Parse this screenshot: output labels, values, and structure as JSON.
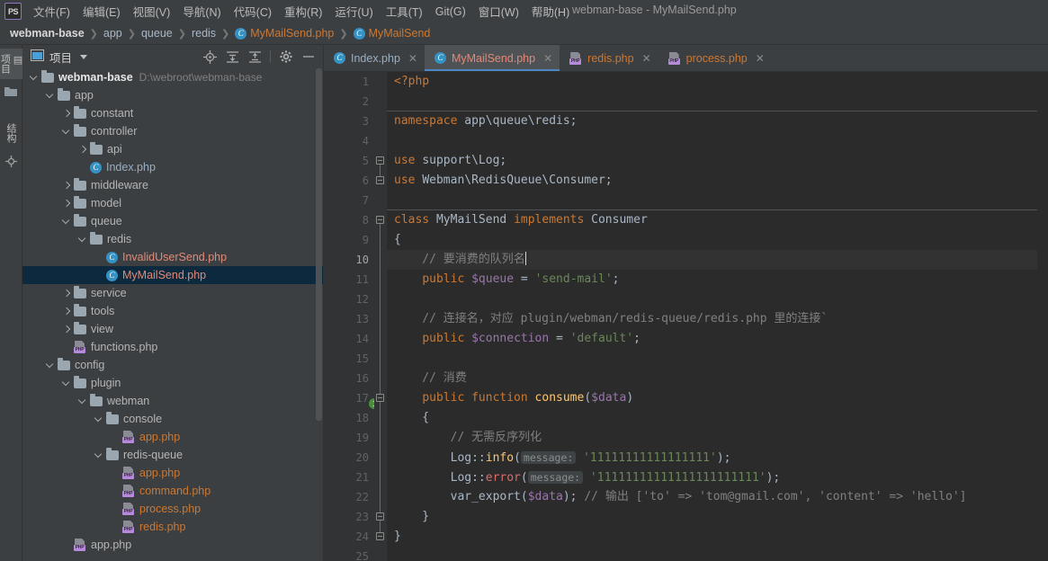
{
  "window": {
    "title": "webman-base - MyMailSend.php",
    "logo_text": "PS"
  },
  "menubar": {
    "items": [
      {
        "label": "文件(F)",
        "name": "menu-file"
      },
      {
        "label": "编辑(E)",
        "name": "menu-edit"
      },
      {
        "label": "视图(V)",
        "name": "menu-view"
      },
      {
        "label": "导航(N)",
        "name": "menu-navigate"
      },
      {
        "label": "代码(C)",
        "name": "menu-code"
      },
      {
        "label": "重构(R)",
        "name": "menu-refactor"
      },
      {
        "label": "运行(U)",
        "name": "menu-run"
      },
      {
        "label": "工具(T)",
        "name": "menu-tools"
      },
      {
        "label": "Git(G)",
        "name": "menu-git"
      },
      {
        "label": "窗口(W)",
        "name": "menu-window"
      },
      {
        "label": "帮助(H)",
        "name": "menu-help"
      }
    ]
  },
  "breadcrumb": {
    "items": [
      {
        "label": "webman-base",
        "kind": "root"
      },
      {
        "label": "app",
        "kind": "dir"
      },
      {
        "label": "queue",
        "kind": "dir"
      },
      {
        "label": "redis",
        "kind": "dir"
      },
      {
        "label": "MyMailSend.php",
        "kind": "file"
      },
      {
        "label": "MyMailSend",
        "kind": "class"
      }
    ],
    "separator": "❯"
  },
  "toolstrip": {
    "project_label": "项目",
    "structure_label": "结构"
  },
  "project_panel": {
    "title": "项目",
    "tools": [
      "locate-icon",
      "expand-all-icon",
      "collapse-all-icon",
      "settings-icon",
      "hide-icon"
    ],
    "tree": [
      {
        "indent": 0,
        "arrow": "open",
        "icon": "folder",
        "label": "webman-base",
        "style": "root",
        "path": "D:\\webroot\\webman-base"
      },
      {
        "indent": 1,
        "arrow": "open",
        "icon": "folder",
        "label": "app",
        "style": "dir"
      },
      {
        "indent": 2,
        "arrow": "closed",
        "icon": "folder",
        "label": "constant",
        "style": "dir"
      },
      {
        "indent": 2,
        "arrow": "open",
        "icon": "folder",
        "label": "controller",
        "style": "dir"
      },
      {
        "indent": 3,
        "arrow": "closed",
        "icon": "folder",
        "label": "api",
        "style": "dir"
      },
      {
        "indent": 3,
        "arrow": "none",
        "icon": "class",
        "label": "Index.php",
        "style": "file-blue"
      },
      {
        "indent": 2,
        "arrow": "closed",
        "icon": "folder",
        "label": "middleware",
        "style": "dir"
      },
      {
        "indent": 2,
        "arrow": "closed",
        "icon": "folder",
        "label": "model",
        "style": "dir"
      },
      {
        "indent": 2,
        "arrow": "open",
        "icon": "folder",
        "label": "queue",
        "style": "dir"
      },
      {
        "indent": 3,
        "arrow": "open",
        "icon": "folder",
        "label": "redis",
        "style": "dir"
      },
      {
        "indent": 4,
        "arrow": "none",
        "icon": "class",
        "label": "InvalidUserSend.php",
        "style": "cls"
      },
      {
        "indent": 4,
        "arrow": "none",
        "icon": "class",
        "label": "MyMailSend.php",
        "style": "cls",
        "selected": true
      },
      {
        "indent": 2,
        "arrow": "closed",
        "icon": "folder",
        "label": "service",
        "style": "dir"
      },
      {
        "indent": 2,
        "arrow": "closed",
        "icon": "folder",
        "label": "tools",
        "style": "dir"
      },
      {
        "indent": 2,
        "arrow": "closed",
        "icon": "folder",
        "label": "view",
        "style": "dir"
      },
      {
        "indent": 2,
        "arrow": "none",
        "icon": "php",
        "label": "functions.php",
        "style": "dir"
      },
      {
        "indent": 1,
        "arrow": "open",
        "icon": "folder",
        "label": "config",
        "style": "dir"
      },
      {
        "indent": 2,
        "arrow": "open",
        "icon": "folder",
        "label": "plugin",
        "style": "dir"
      },
      {
        "indent": 3,
        "arrow": "open",
        "icon": "folder",
        "label": "webman",
        "style": "dir"
      },
      {
        "indent": 4,
        "arrow": "open",
        "icon": "folder",
        "label": "console",
        "style": "dir"
      },
      {
        "indent": 5,
        "arrow": "none",
        "icon": "php",
        "label": "app.php",
        "style": "php"
      },
      {
        "indent": 4,
        "arrow": "open",
        "icon": "folder",
        "label": "redis-queue",
        "style": "dir"
      },
      {
        "indent": 5,
        "arrow": "none",
        "icon": "php",
        "label": "app.php",
        "style": "php"
      },
      {
        "indent": 5,
        "arrow": "none",
        "icon": "php",
        "label": "command.php",
        "style": "php"
      },
      {
        "indent": 5,
        "arrow": "none",
        "icon": "php",
        "label": "process.php",
        "style": "php"
      },
      {
        "indent": 5,
        "arrow": "none",
        "icon": "php",
        "label": "redis.php",
        "style": "php"
      },
      {
        "indent": 2,
        "arrow": "none",
        "icon": "php",
        "label": "app.php",
        "style": "dir"
      }
    ]
  },
  "editor": {
    "tabs": [
      {
        "label": "Index.php",
        "icon": "class-icon",
        "active": false,
        "color": "blue"
      },
      {
        "label": "MyMailSend.php",
        "icon": "class-icon",
        "active": true,
        "color": "orange"
      },
      {
        "label": "redis.php",
        "icon": "php-icon",
        "active": false,
        "color": "orange"
      },
      {
        "label": "process.php",
        "icon": "php-icon",
        "active": false,
        "color": "orange"
      }
    ],
    "close_glyph": "✕",
    "gutter_marker_line17": "1",
    "line_numbers": [
      1,
      2,
      3,
      4,
      5,
      6,
      7,
      8,
      9,
      10,
      11,
      12,
      13,
      14,
      15,
      16,
      17,
      18,
      19,
      20,
      21,
      22,
      23,
      24,
      25
    ],
    "current_line": 10,
    "code_lines": [
      {
        "n": 1,
        "tokens": [
          {
            "t": "<?php",
            "c": "kw"
          }
        ]
      },
      {
        "n": 2,
        "tokens": []
      },
      {
        "n": 3,
        "tokens": [
          {
            "t": "namespace ",
            "c": "kw"
          },
          {
            "t": "app\\queue\\redis;",
            "c": "cls2"
          }
        ]
      },
      {
        "n": 4,
        "tokens": []
      },
      {
        "n": 5,
        "tokens": [
          {
            "t": "use ",
            "c": "kw"
          },
          {
            "t": "support\\Log;",
            "c": "cls2"
          }
        ]
      },
      {
        "n": 6,
        "tokens": [
          {
            "t": "use ",
            "c": "kw"
          },
          {
            "t": "Webman\\RedisQueue\\Consumer;",
            "c": "cls2"
          }
        ]
      },
      {
        "n": 7,
        "tokens": []
      },
      {
        "n": 8,
        "tokens": [
          {
            "t": "class ",
            "c": "kw"
          },
          {
            "t": "MyMailSend ",
            "c": "cls2"
          },
          {
            "t": "implements ",
            "c": "kw"
          },
          {
            "t": "Consumer",
            "c": "cls2"
          }
        ]
      },
      {
        "n": 9,
        "tokens": [
          {
            "t": "{",
            "c": "cls2"
          }
        ]
      },
      {
        "n": 10,
        "tokens": [
          {
            "t": "    // 要消费的队列名",
            "c": "cmt"
          }
        ],
        "caret": true,
        "highlight": true
      },
      {
        "n": 11,
        "tokens": [
          {
            "t": "    ",
            "c": "cls2"
          },
          {
            "t": "public ",
            "c": "kw"
          },
          {
            "t": "$queue",
            "c": "var"
          },
          {
            "t": " = ",
            "c": "cls2"
          },
          {
            "t": "'send-mail'",
            "c": "str"
          },
          {
            "t": ";",
            "c": "cls2"
          }
        ]
      },
      {
        "n": 12,
        "tokens": []
      },
      {
        "n": 13,
        "tokens": [
          {
            "t": "    // 连接名，对应 plugin/webman/redis-queue/redis.php 里的连接`",
            "c": "cmt"
          }
        ]
      },
      {
        "n": 14,
        "tokens": [
          {
            "t": "    ",
            "c": "cls2"
          },
          {
            "t": "public ",
            "c": "kw"
          },
          {
            "t": "$connection",
            "c": "var"
          },
          {
            "t": " = ",
            "c": "cls2"
          },
          {
            "t": "'default'",
            "c": "str"
          },
          {
            "t": ";",
            "c": "cls2"
          }
        ]
      },
      {
        "n": 15,
        "tokens": []
      },
      {
        "n": 16,
        "tokens": [
          {
            "t": "    // 消费",
            "c": "cmt"
          }
        ]
      },
      {
        "n": 17,
        "tokens": [
          {
            "t": "    ",
            "c": "cls2"
          },
          {
            "t": "public function ",
            "c": "kw"
          },
          {
            "t": "consume",
            "c": "fn"
          },
          {
            "t": "(",
            "c": "cls2"
          },
          {
            "t": "$data",
            "c": "var"
          },
          {
            "t": ")",
            "c": "cls2"
          }
        ]
      },
      {
        "n": 18,
        "tokens": [
          {
            "t": "    {",
            "c": "cls2"
          }
        ]
      },
      {
        "n": 19,
        "tokens": [
          {
            "t": "        // 无需反序列化",
            "c": "cmt"
          }
        ]
      },
      {
        "n": 20,
        "tokens": [
          {
            "t": "        Log::",
            "c": "cls2"
          },
          {
            "t": "info",
            "c": "fn"
          },
          {
            "t": "(",
            "c": "cls2"
          },
          {
            "t": "message:",
            "c": "hint"
          },
          {
            "t": " '11111111111111111'",
            "c": "str"
          },
          {
            "t": ");",
            "c": "cls2"
          }
        ]
      },
      {
        "n": 21,
        "tokens": [
          {
            "t": "        Log::",
            "c": "cls2"
          },
          {
            "t": "error",
            "c": "err"
          },
          {
            "t": "(",
            "c": "cls2"
          },
          {
            "t": "message:",
            "c": "hint"
          },
          {
            "t": " '11111111111111111111111'",
            "c": "str"
          },
          {
            "t": ");",
            "c": "cls2"
          }
        ]
      },
      {
        "n": 22,
        "tokens": [
          {
            "t": "        var_export(",
            "c": "cls2"
          },
          {
            "t": "$data",
            "c": "var"
          },
          {
            "t": "); ",
            "c": "cls2"
          },
          {
            "t": "// 输出 ['to' => 'tom@gmail.com', 'content' => 'hello']",
            "c": "cmt"
          }
        ]
      },
      {
        "n": 23,
        "tokens": [
          {
            "t": "    }",
            "c": "cls2"
          }
        ]
      },
      {
        "n": 24,
        "tokens": [
          {
            "t": "}",
            "c": "cls2"
          }
        ]
      },
      {
        "n": 25,
        "tokens": []
      }
    ]
  },
  "colors": {
    "bg_chrome": "#3c3f41",
    "bg_editor": "#2b2b2b",
    "bg_gutter": "#313335",
    "accent_tab": "#4a88c7",
    "selection": "#0d293e",
    "keyword": "#cc7832",
    "string": "#6a8759",
    "comment": "#808080",
    "variable": "#9876aa",
    "function": "#ffc66d",
    "class_icon": "#3592c4",
    "php_icon": "#b58adb"
  }
}
